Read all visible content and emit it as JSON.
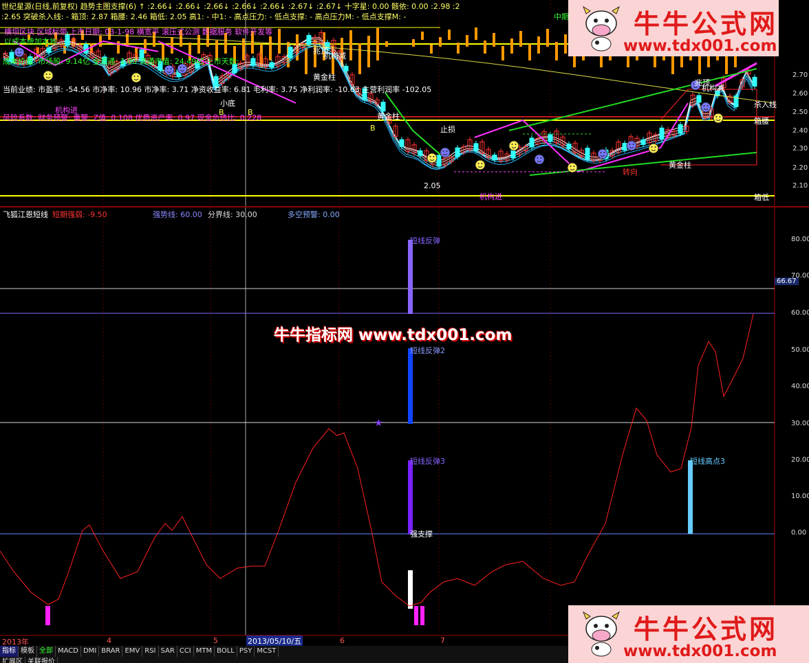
{
  "top_panel": {
    "title_line1": "世纪星源(日线,前复权) 趋势主图支撑(6) ↑ :2.66↓ :2.66↓ :2.66↓ :2.66↓ :2.66↓ :2.67↓ :2.67↓ 十字星: 0.00 骸依: 0.00 :2.98 :2",
    "title_line2": ":2.65   突破杀入线: -  箱顶: 2.87  箱腰: 2.46  箱低: 2.05  高1: -  中1: -   高点压力: -  低点支撑: -  高点压力M: -  低点支撑M: -",
    "title_line2_right": "中期",
    "info_performance": "当前业绩: 市盈率: -54.56 市净率: 10.96 市净率: 3.71 净资收益率: 6.81 毛利率: 3.75 净利润率: -10.63 主营利润率 -102.05",
    "info_risk": "风险系数: 财务预警: 重警; Z值: 0.108 优质资产率: 0.97 现金负债比: 0.228",
    "info_cost": "成本价值: 市场股: 9.14亿 全流通: 1.00 流通市值: 24.49亿 上市天数:",
    "info_top": "横坝区块  区域标带    上市日期: 03-1-98    横宽平  滚压式公测   数据服务   软件开发等",
    "info_cost2": "以成本统加本地",
    "label_box_top": "杀入线",
    "label_box_mid": "箱腰",
    "label_box_low": "箱低",
    "label_low_price": "2.05",
    "label_gold1": "黄金柱",
    "label_gold2": "黄金柱",
    "label_gold3": "黄金柱",
    "label_jigoujin": "机构进",
    "label_jigoujin2": "机构进",
    "label_jigoujian": "机构减",
    "label_jigoujian2": "机构减",
    "label_zhaoding": "兆顶",
    "label_zhaoding2": "兆顶",
    "label_xiaodi": "小底",
    "label_zhisun": "止损",
    "label_zhuanxiang": "转向",
    "label_b": "B",
    "price_ticks": [
      "2.70",
      "2.60",
      "2.50",
      "2.40",
      "2.30",
      "2.20",
      "2.10"
    ]
  },
  "bottom_panel": {
    "name": "飞狐江恩短线",
    "short_strength_label": "短期强弱: -9.50",
    "strong_line": "强势线: 60.00",
    "divide_line": "分界线: 30.00",
    "long_short": "多空预警: 0.00",
    "bar_labels": [
      "短线反弹",
      "短线反弹2",
      "短线反弹3",
      "短线高点3",
      "强支撑"
    ],
    "axis_ticks": [
      "80.00",
      "70.00",
      "60.00",
      "50.00",
      "40.00",
      "30.00",
      "20.00",
      "10.00",
      "0.00"
    ],
    "cursor_value": "66.67"
  },
  "watermark": {
    "center": "牛牛指标网 www.tdx001.com",
    "logo_title": "牛牛公式网",
    "logo_url": "www.tdx001.com"
  },
  "date_axis": {
    "labels": [
      "2013年",
      "4",
      "5",
      "2013/05/10/五",
      "6",
      "7"
    ]
  },
  "bottom_tabs": {
    "items": [
      "指标",
      "模板",
      "全部",
      "MACD",
      "DMI",
      "BRAR",
      "EMV",
      "RSI",
      "SAR",
      "CCI",
      "MTM",
      "BOLL",
      "PSY",
      "MCST"
    ],
    "row2": [
      "扩展区",
      "关联报价"
    ]
  },
  "colors": {
    "background": "#000000",
    "grid_red": "#8b0000",
    "up_candle": "#ff3333",
    "down_candle": "#33ffff",
    "yellow": "#ffff00",
    "oscillator": "#ff2020",
    "brand_red": "#e01a1a"
  }
}
